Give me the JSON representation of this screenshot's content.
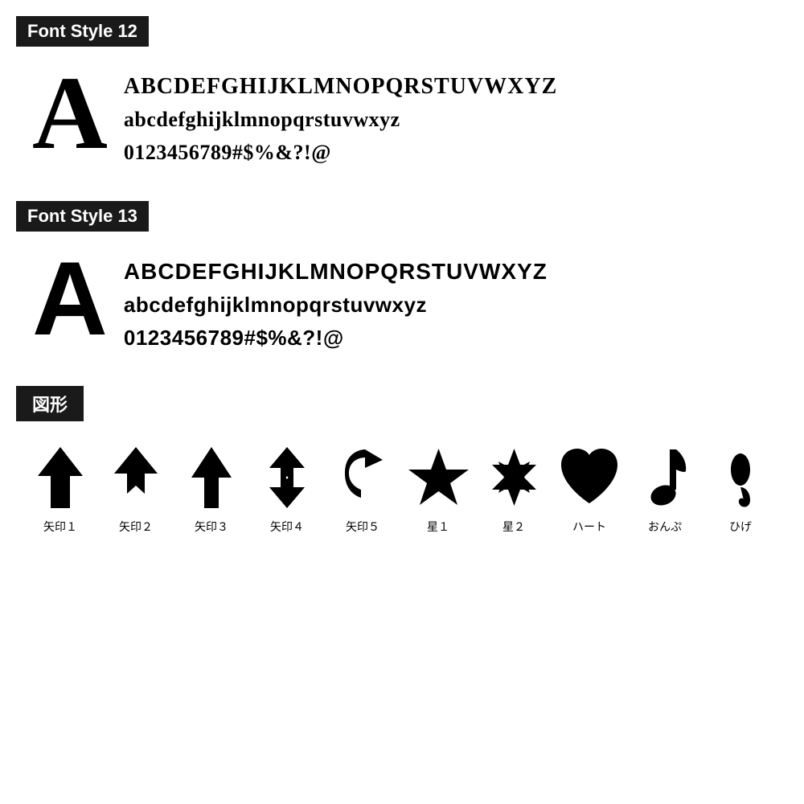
{
  "sections": [
    {
      "id": "font-style-12",
      "label": "Font Style 12",
      "big_letter": "A",
      "charset": {
        "line1": "BCDEFGHIJKLMNOPQRSTUVWXYZ",
        "line2": "abcdefghijklmnopqrstuvwxyz",
        "line3": "0123456789#$%&?!@"
      }
    },
    {
      "id": "font-style-13",
      "label": "Font Style 13",
      "big_letter": "A",
      "charset": {
        "line1": "BCDEFGHIJKLMNOPQRSTUVWXYZ",
        "line2": "abcdefghijklmnopqrstuvwxyz",
        "line3": "0123456789#$%&?!@"
      }
    }
  ],
  "shapes_section": {
    "label": "図形",
    "shapes": [
      {
        "id": "yajirushi1",
        "label": "矢印１"
      },
      {
        "id": "yajirushi2",
        "label": "矢印２"
      },
      {
        "id": "yajirushi3",
        "label": "矢印３"
      },
      {
        "id": "yajirushi4",
        "label": "矢印４"
      },
      {
        "id": "yajirushi5",
        "label": "矢印５"
      },
      {
        "id": "hoshi1",
        "label": "星１"
      },
      {
        "id": "hoshi2",
        "label": "星２"
      },
      {
        "id": "heart",
        "label": "ハート"
      },
      {
        "id": "onpu",
        "label": "おんぷ"
      },
      {
        "id": "hige",
        "label": "ひげ"
      }
    ]
  }
}
